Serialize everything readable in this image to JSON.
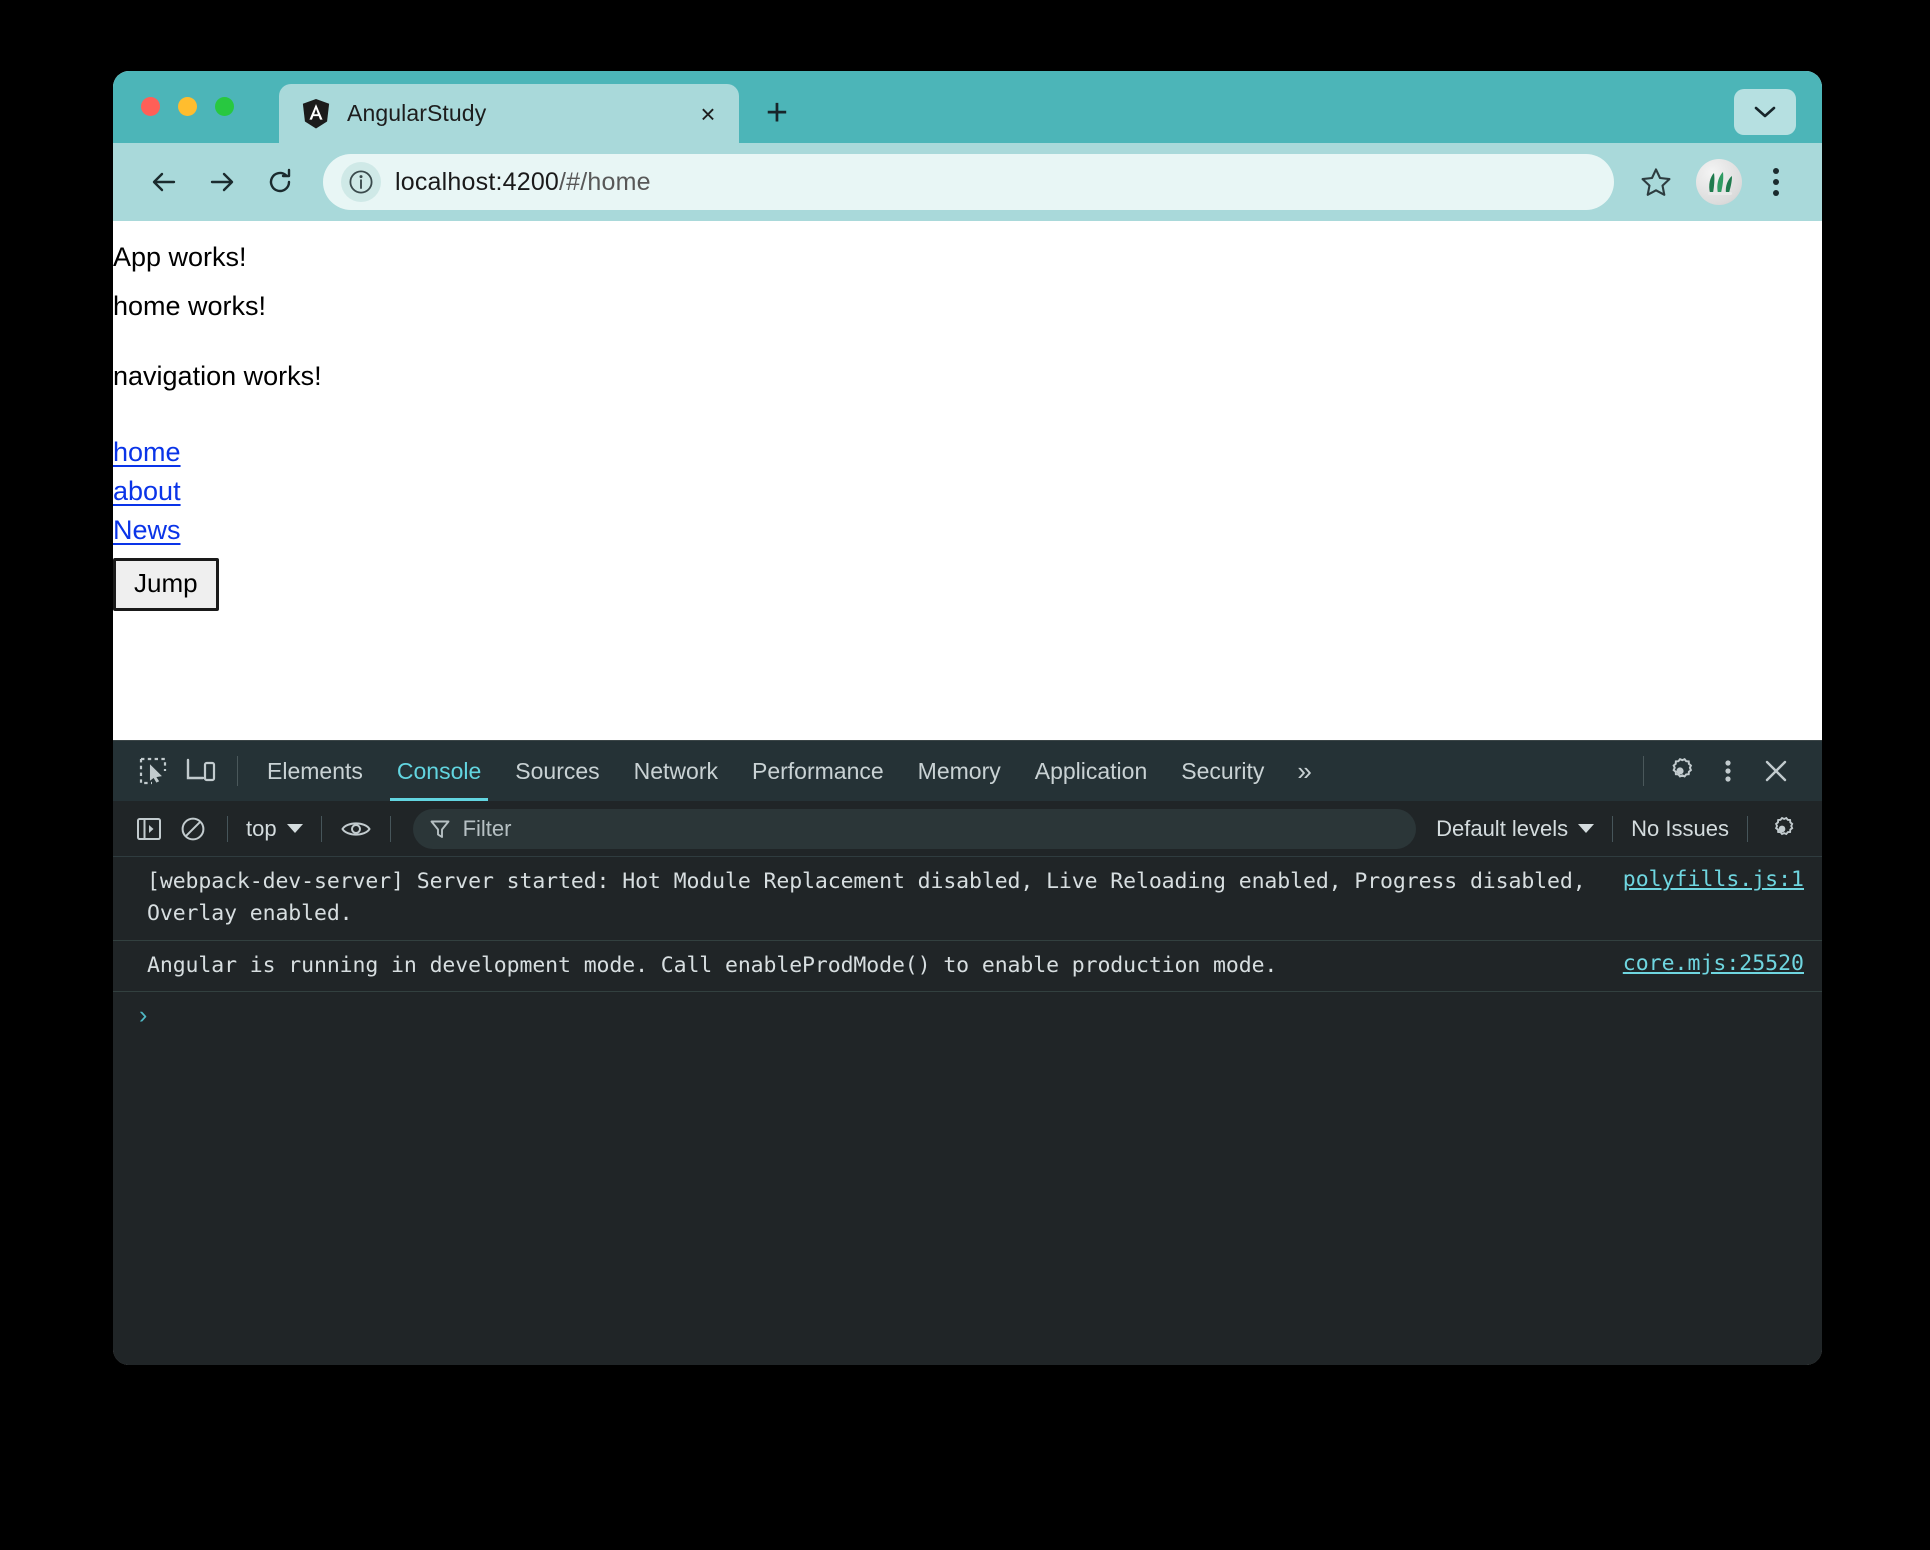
{
  "window": {
    "traffic_lights": [
      "close",
      "minimize",
      "maximize"
    ],
    "menu_icon": "chevron-down-icon"
  },
  "tabs": {
    "active": {
      "title": "AngularStudy",
      "favicon": "angular-logo-icon",
      "close_label": "×"
    },
    "new_tab_label": "+"
  },
  "toolbar": {
    "back_icon": "arrow-left-icon",
    "forward_icon": "arrow-right-icon",
    "reload_icon": "reload-icon",
    "site_info_icon": "info-circle-icon",
    "url_host": "localhost:4200",
    "url_path": "/#/home",
    "url_full": "localhost:4200/#/home",
    "bookmark_icon": "star-icon",
    "profile_icon": "plant-avatar-icon",
    "menu_icon": "kebab-menu-icon"
  },
  "page": {
    "app_works": "App works!",
    "home_works": "home works!",
    "navigation_works": "navigation works!",
    "links": [
      {
        "label": "home"
      },
      {
        "label": "about"
      },
      {
        "label": "News"
      }
    ],
    "jump_button": "Jump"
  },
  "devtools": {
    "inspect_icon": "inspect-element-icon",
    "device_icon": "device-toolbar-icon",
    "tabs": [
      {
        "label": "Elements",
        "active": false
      },
      {
        "label": "Console",
        "active": true
      },
      {
        "label": "Sources",
        "active": false
      },
      {
        "label": "Network",
        "active": false
      },
      {
        "label": "Performance",
        "active": false
      },
      {
        "label": "Memory",
        "active": false
      },
      {
        "label": "Application",
        "active": false
      },
      {
        "label": "Security",
        "active": false
      }
    ],
    "more_tabs_label": "»",
    "settings_icon": "gear-icon",
    "more_options_icon": "kebab-menu-icon",
    "close_icon": "close-icon",
    "console_toolbar": {
      "sidebar_icon": "console-sidebar-icon",
      "clear_icon": "clear-console-icon",
      "context": "top",
      "eye_icon": "live-expression-eye-icon",
      "filter_icon": "filter-funnel-icon",
      "filter_placeholder": "Filter",
      "filter_value": "",
      "levels": "Default levels",
      "issues": "No Issues",
      "settings_icon": "gear-icon"
    },
    "console_messages": [
      {
        "text": "[webpack-dev-server] Server started: Hot Module Replacement disabled, Live Reloading enabled, Progress disabled, Overlay enabled.",
        "source": "polyfills.js:1"
      },
      {
        "text": "Angular is running in development mode. Call enableProdMode() to enable production mode.",
        "source": "core.mjs:25520"
      }
    ],
    "prompt_caret": "›",
    "prompt_value": ""
  },
  "colors": {
    "titlebar": "#4cb5b8",
    "toolbar": "#a9d9da",
    "omnibox": "#e8f6f5",
    "devtools_bg": "#202527",
    "devtools_tabbar": "#253236",
    "accent_teal": "#62d5e0",
    "link_blue": "#0a34e8",
    "source_link": "#6fd6e0"
  }
}
